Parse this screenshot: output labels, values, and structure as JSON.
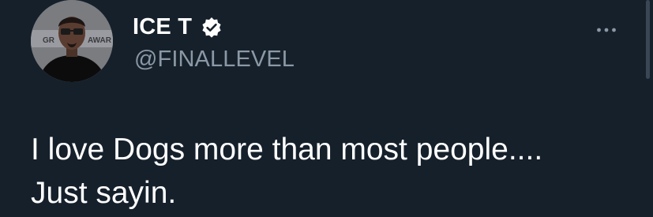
{
  "user": {
    "display_name": "ICE T",
    "handle": "@FINALLEVEL",
    "verified": true,
    "verified_icon": "verified-check-icon",
    "avatar_icon": "profile-photo-avatar",
    "avatar_backdrop_text_left": "GR",
    "avatar_backdrop_text_right": "AWAR"
  },
  "tweet": {
    "lines": [
      "I love Dogs more than most people....",
      "Just sayin."
    ]
  },
  "menu": {
    "more_icon": "more-options-ellipsis-icon"
  },
  "colors": {
    "background": "#15202b",
    "text_primary": "#ffffff",
    "text_secondary": "#8b98a5"
  }
}
